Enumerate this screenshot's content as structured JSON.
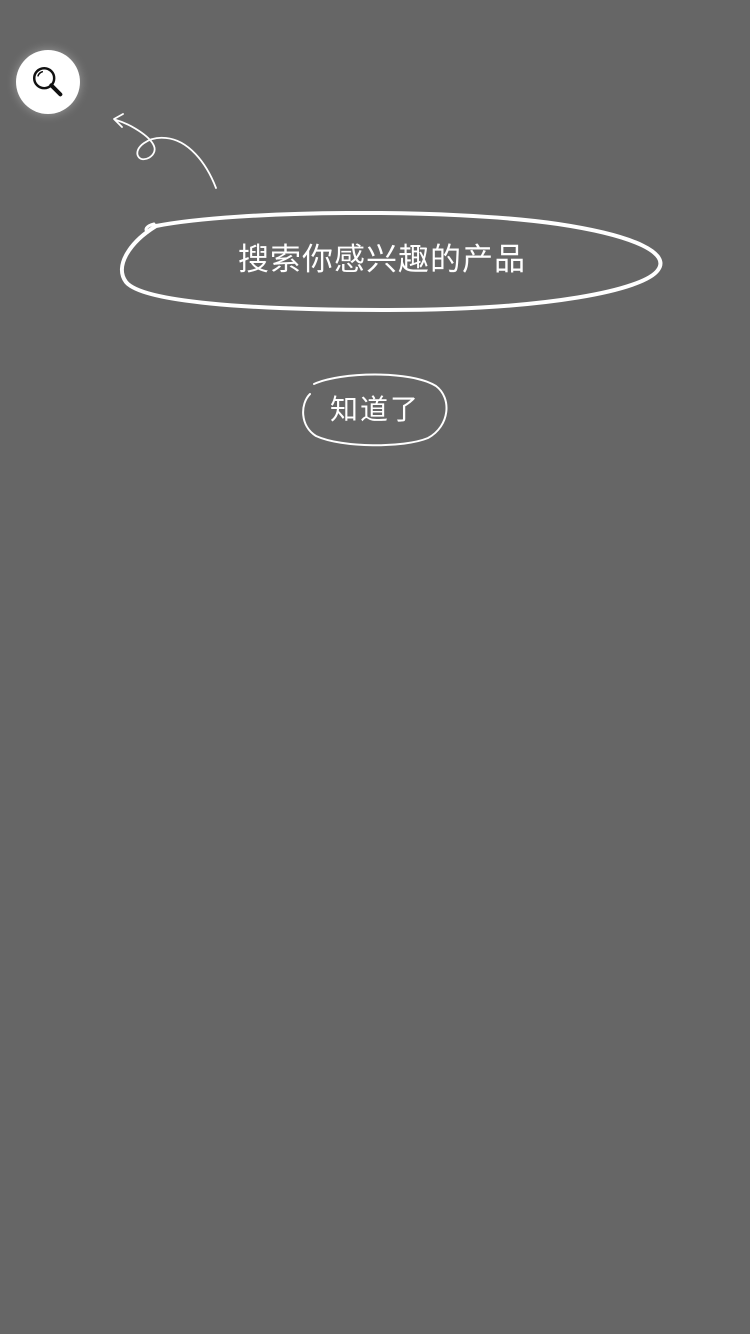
{
  "overlay": {
    "background_color": "#666666"
  },
  "search_highlight": {
    "icon": "search-icon",
    "color": "#ffffff"
  },
  "tip": {
    "text": "搜索你感兴趣的产品"
  },
  "dismiss_button": {
    "label": "知道了"
  }
}
